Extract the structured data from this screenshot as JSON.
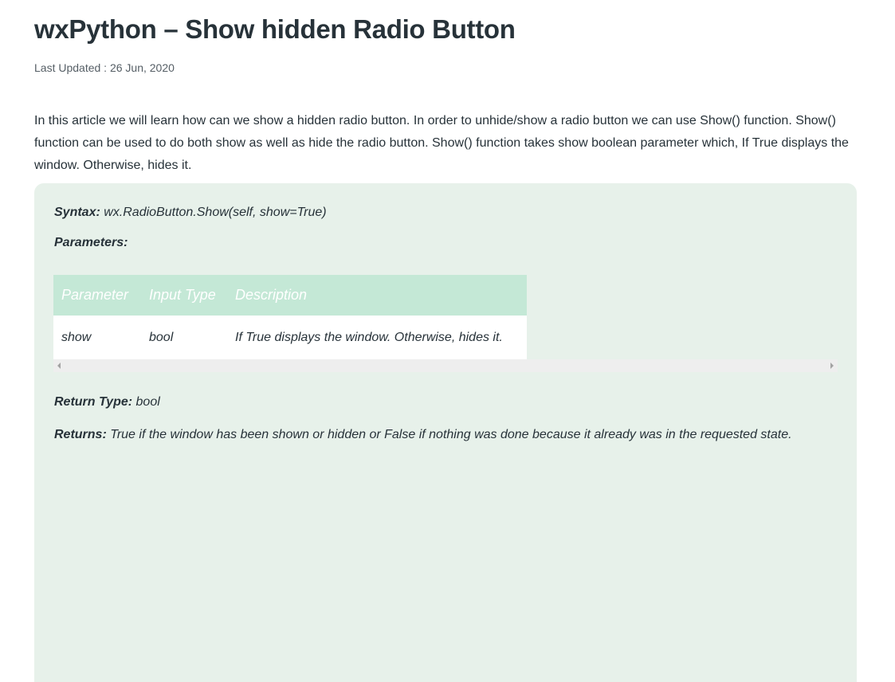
{
  "article": {
    "title": "wxPython – Show hidden Radio Button",
    "last_updated": "Last Updated : 26 Jun, 2020",
    "intro": "In this article we will learn how can we show a hidden radio button. In order to unhide/show a radio button we can use Show() function. Show() function can be used to do both show as well as hide the radio button. Show() function takes show boolean parameter which, If True displays the window. Otherwise, hides it."
  },
  "syntax_box": {
    "syntax_label": "Syntax:",
    "syntax_value": " wx.RadioButton.Show(self, show=True)",
    "parameters_label": "Parameters:",
    "table": {
      "headers": [
        "Parameter",
        "Input Type",
        "Description"
      ],
      "rows": [
        [
          "show",
          "bool",
          "If True displays the window. Otherwise, hides it."
        ]
      ]
    },
    "return_type_label": "Return Type:",
    "return_type_value": " bool",
    "returns_label": "Returns:",
    "returns_value": " True if the window has been shown or hidden or False if nothing was done because it already was in the requested state."
  },
  "colors": {
    "box_background": "#e7f1ea",
    "table_header": "#c4e8d6",
    "text": "#273239"
  }
}
